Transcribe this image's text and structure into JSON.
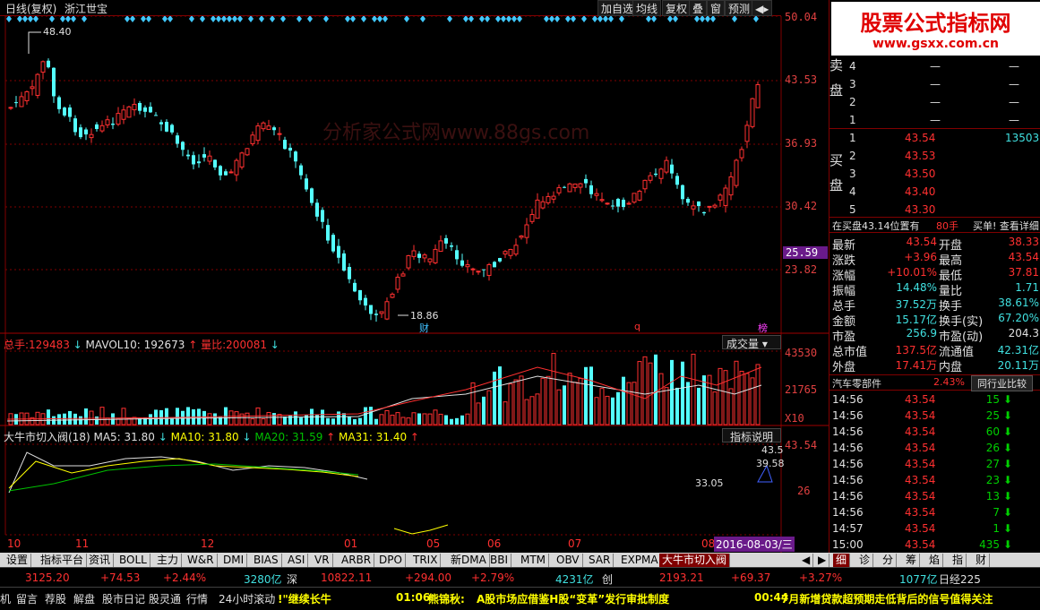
{
  "title": {
    "period": "日线(复权)",
    "stock": "浙江世宝"
  },
  "toolbar": [
    "加自选",
    "均线",
    "复权",
    "叠",
    "窗",
    "预测"
  ],
  "price_axis": [
    "50.04",
    "43.53",
    "36.93",
    "30.42",
    "25.59",
    "23.82"
  ],
  "price_marks": {
    "high": "48.40",
    "low": "18.86"
  },
  "markers": {
    "cai": "财",
    "q": "q",
    "bang": "榜"
  },
  "watermark": "分析家公式网www.88gs.com",
  "volume": {
    "total_label": "总手:",
    "total": "129483",
    "mavol_label": "MAVOL10:",
    "mavol": "192673",
    "ratio_label": "量比:",
    "ratio": "200081",
    "dropdown": "成交量",
    "axis_top": "43530",
    "axis_mid": "21765",
    "axis_unit": "X10"
  },
  "indicator": {
    "name": "大牛市切入阀(18)",
    "ma5": "MA5: 31.80",
    "ma10": "MA10: 31.80",
    "ma20": "MA20: 31.59",
    "ma31": "MA31: 31.40",
    "help": "指标说明",
    "axis_top": "43.54",
    "axis_mid": "26",
    "val1": "43.5",
    "val2": "39.58",
    "val3": "33.05"
  },
  "date_axis": [
    "10",
    "11",
    "12",
    "01",
    "05",
    "06",
    "07",
    "08"
  ],
  "cursor_date": "2016-08-03/三",
  "logo": {
    "cn": "股票公式指标网",
    "url": "www.gsxx.com.cn"
  },
  "order_book": {
    "sell_label": [
      "卖",
      "盘"
    ],
    "sell": [
      {
        "n": "4",
        "p": "—",
        "v": "—"
      },
      {
        "n": "3",
        "p": "—",
        "v": "—"
      },
      {
        "n": "2",
        "p": "—",
        "v": "—"
      },
      {
        "n": "1",
        "p": "—",
        "v": "—"
      }
    ],
    "buy_label": [
      "买",
      "盘"
    ],
    "buy": [
      {
        "n": "1",
        "p": "43.54",
        "v": "13503"
      },
      {
        "n": "2",
        "p": "43.53",
        "v": ""
      },
      {
        "n": "3",
        "p": "43.50",
        "v": ""
      },
      {
        "n": "4",
        "p": "43.40",
        "v": ""
      },
      {
        "n": "5",
        "p": "43.30",
        "v": ""
      }
    ]
  },
  "buy_status": {
    "text": "在买盘43.14位置有",
    "lots": "80手",
    "link": "买单! 查看详细"
  },
  "quote": [
    {
      "l1": "最新",
      "v1": "43.54",
      "l2": "开盘",
      "v2": "38.33"
    },
    {
      "l1": "涨跌",
      "v1": "+3.96",
      "l2": "最高",
      "v2": "43.54"
    },
    {
      "l1": "涨幅",
      "v1": "+10.01%",
      "l2": "最低",
      "v2": "37.81"
    },
    {
      "l1": "振幅",
      "v1": "14.48%",
      "l2": "量比",
      "v2": "1.71"
    },
    {
      "l1": "总手",
      "v1": "37.52万",
      "l2": "换手",
      "v2": "38.61%"
    },
    {
      "l1": "金额",
      "v1": "15.17亿",
      "l2": "换手(实)",
      "v2": "67.20%"
    },
    {
      "l1": "市盈",
      "v1": "256.9",
      "l2": "市盈(动)",
      "v2": "204.3"
    },
    {
      "l1": "总市值",
      "v1": "137.5亿",
      "l2": "流通值",
      "v2": "42.31亿"
    },
    {
      "l1": "外盘",
      "v1": "17.41万",
      "l2": "内盘",
      "v2": "20.11万"
    }
  ],
  "sector": {
    "name": "汽车零部件",
    "pct": "2.43%",
    "btn": "同行业比较"
  },
  "ticks": [
    {
      "t": "14:56",
      "p": "43.54",
      "v": "15"
    },
    {
      "t": "14:56",
      "p": "43.54",
      "v": "25"
    },
    {
      "t": "14:56",
      "p": "43.54",
      "v": "60"
    },
    {
      "t": "14:56",
      "p": "43.54",
      "v": "26"
    },
    {
      "t": "14:56",
      "p": "43.54",
      "v": "27"
    },
    {
      "t": "14:56",
      "p": "43.54",
      "v": "23"
    },
    {
      "t": "14:56",
      "p": "43.54",
      "v": "13"
    },
    {
      "t": "14:56",
      "p": "43.54",
      "v": "7"
    },
    {
      "t": "14:57",
      "p": "43.54",
      "v": "1"
    },
    {
      "t": "15:00",
      "p": "43.54",
      "v": "435"
    }
  ],
  "tabs": [
    "设置",
    "指标平台",
    "资讯",
    "BOLL",
    "主力",
    "W&R",
    "DMI",
    "BIAS",
    "ASI",
    "VR",
    "ARBR",
    "DPO",
    "TRIX",
    "新DMA",
    "BBI",
    "MTM",
    "OBV",
    "SAR",
    "EXPMA",
    "大牛市切入阀"
  ],
  "right_tabs": [
    "细",
    "诊",
    "分",
    "筹",
    "焰",
    "指",
    "财"
  ],
  "index_bar": [
    {
      "v": "3125.20",
      "c": "red"
    },
    {
      "v": "+74.53",
      "c": "red"
    },
    {
      "v": "+2.44%",
      "c": "red"
    },
    {
      "v": "3280亿",
      "c": "cyn"
    },
    {
      "v": "深",
      "c": "wht"
    },
    {
      "v": "10822.11",
      "c": "red"
    },
    {
      "v": "+294.00",
      "c": "red"
    },
    {
      "v": "+2.79%",
      "c": "red"
    },
    {
      "v": "4231亿",
      "c": "cyn"
    },
    {
      "v": "创",
      "c": "wht"
    },
    {
      "v": "2193.21",
      "c": "red"
    },
    {
      "v": "+69.37",
      "c": "red"
    },
    {
      "v": "+3.27%",
      "c": "red"
    },
    {
      "v": "1077亿",
      "c": "cyn"
    },
    {
      "v": "日经225",
      "c": "wht"
    }
  ],
  "news_bar": [
    {
      "v": "机",
      "c": "wht"
    },
    {
      "v": "留言",
      "c": "wht"
    },
    {
      "v": "荐股",
      "c": "wht"
    },
    {
      "v": "解盘",
      "c": "wht"
    },
    {
      "v": "股市日记",
      "c": "wht"
    },
    {
      "v": "股灵通",
      "c": "wht"
    },
    {
      "v": "行情",
      "c": "wht"
    },
    {
      "v": "24小时滚动",
      "c": "wht"
    },
    {
      "v": "!\"继续长牛",
      "c": "yel"
    },
    {
      "v": "01:06",
      "c": "yel"
    },
    {
      "v": "熊锦秋:",
      "c": "yel"
    },
    {
      "v": "A股市场应借鉴H股“变革”发行审批制度",
      "c": "yel"
    },
    {
      "v": "00:44",
      "c": "yel"
    },
    {
      "v": "7月新增贷款超预期走低背后的信号值得关注",
      "c": "yel"
    }
  ]
}
